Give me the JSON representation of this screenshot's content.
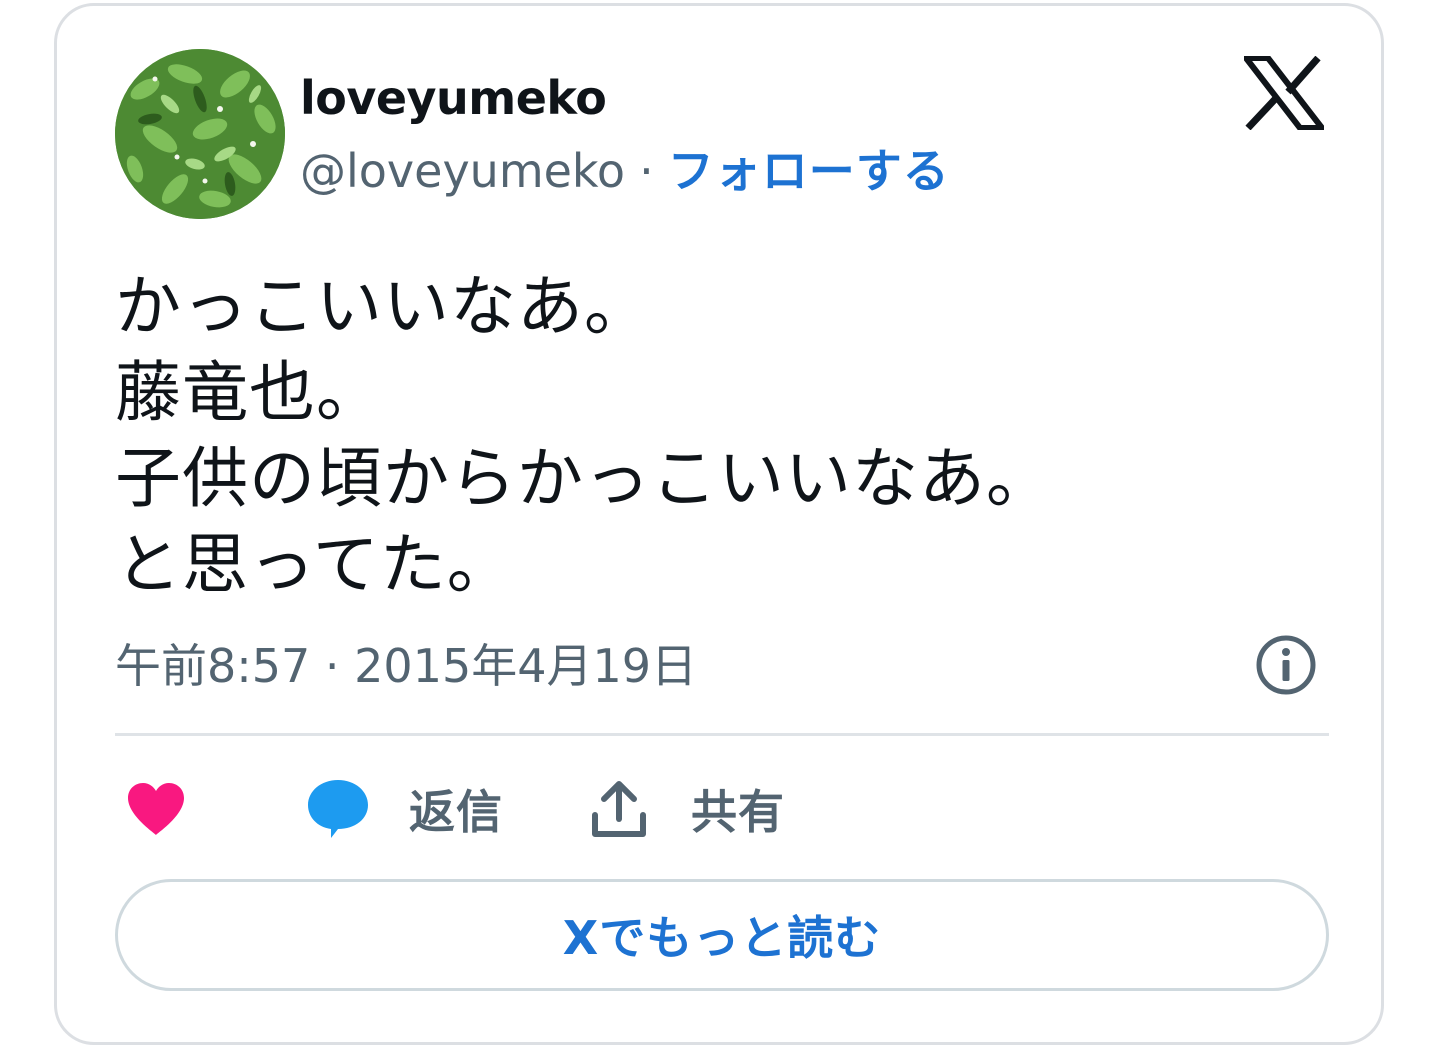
{
  "author": {
    "display_name": "loveyumeko",
    "handle": "@loveyumeko",
    "separator": "·",
    "follow_label": "フォローする"
  },
  "tweet": {
    "lines": [
      "かっこいいなあ。",
      "藤竜也。",
      "子供の頃からかっこいいなあ。",
      "と思ってた。"
    ],
    "timestamp": "午前8:57 · 2015年4月19日"
  },
  "actions": {
    "reply_label": "返信",
    "share_label": "共有"
  },
  "read_more_label": "Xでもっと読む",
  "icons": {
    "brand": "x-logo-icon",
    "info": "info-icon",
    "like": "heart-icon",
    "reply": "speech-bubble-icon",
    "share": "share-upload-icon"
  },
  "colors": {
    "accent": "#1d72d2",
    "like": "#f91880",
    "reply": "#1d9bf0",
    "text": "#0f1419",
    "secondary": "#536471",
    "border": "#cfd9de"
  }
}
